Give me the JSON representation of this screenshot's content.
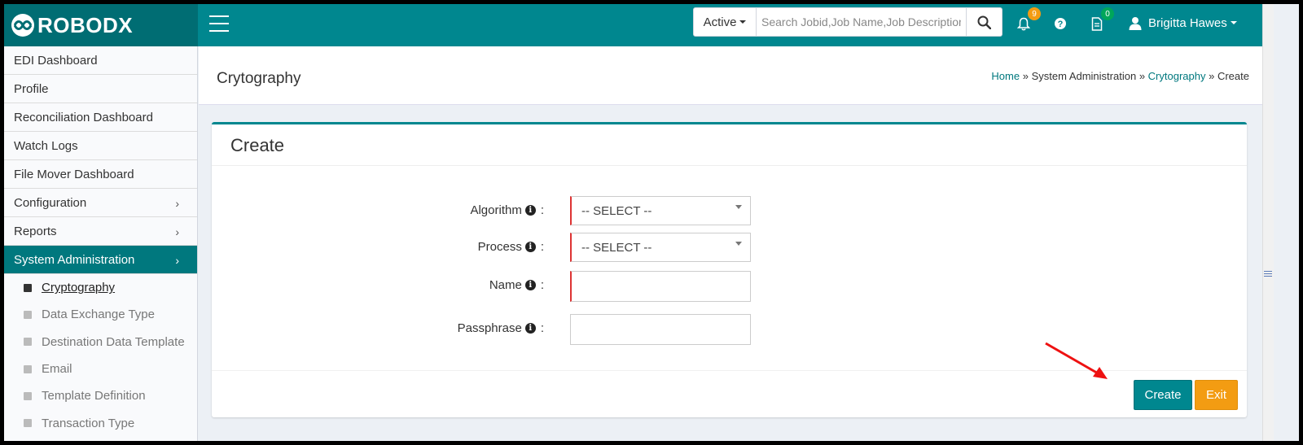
{
  "app": {
    "logo_text": "ROBODX"
  },
  "topbar": {
    "status_filter": "Active",
    "search_placeholder": "Search Jobid,Job Name,Job Description,Dept",
    "notifications_count": "9",
    "tasks_count": "0",
    "user_name": "Brigitta Hawes"
  },
  "sidebar": {
    "items": [
      {
        "label": "EDI Dashboard"
      },
      {
        "label": "Profile"
      },
      {
        "label": "Reconciliation Dashboard"
      },
      {
        "label": "Watch Logs"
      },
      {
        "label": "File Mover Dashboard"
      },
      {
        "label": "Configuration",
        "chevron": "›"
      },
      {
        "label": "Reports",
        "chevron": "›"
      },
      {
        "label": "System Administration",
        "chevron": "›"
      }
    ],
    "sub_items": [
      {
        "label": "Cryptography"
      },
      {
        "label": "Data Exchange Type"
      },
      {
        "label": "Destination Data Template"
      },
      {
        "label": "Email"
      },
      {
        "label": "Template Definition"
      },
      {
        "label": "Transaction Type"
      }
    ]
  },
  "header": {
    "title": "Crytography",
    "breadcrumb": {
      "home": "Home",
      "sep1": "»",
      "section": "System Administration",
      "sep2": "»",
      "page": "Crytography",
      "sep3": "»",
      "current": "Create"
    }
  },
  "form": {
    "title": "Create",
    "algorithm_label": "Algorithm",
    "algorithm_value": "-- SELECT --",
    "process_label": "Process",
    "process_value": "-- SELECT --",
    "name_label": "Name",
    "name_value": "",
    "passphrase_label": "Passphrase",
    "passphrase_value": "",
    "colon": ":",
    "info_glyph": "i",
    "create_label": "Create",
    "exit_label": "Exit"
  },
  "colors": {
    "primary": "#00878f",
    "sidebar_active": "#00787e",
    "exit": "#f39c12",
    "required": "#dd3333"
  }
}
